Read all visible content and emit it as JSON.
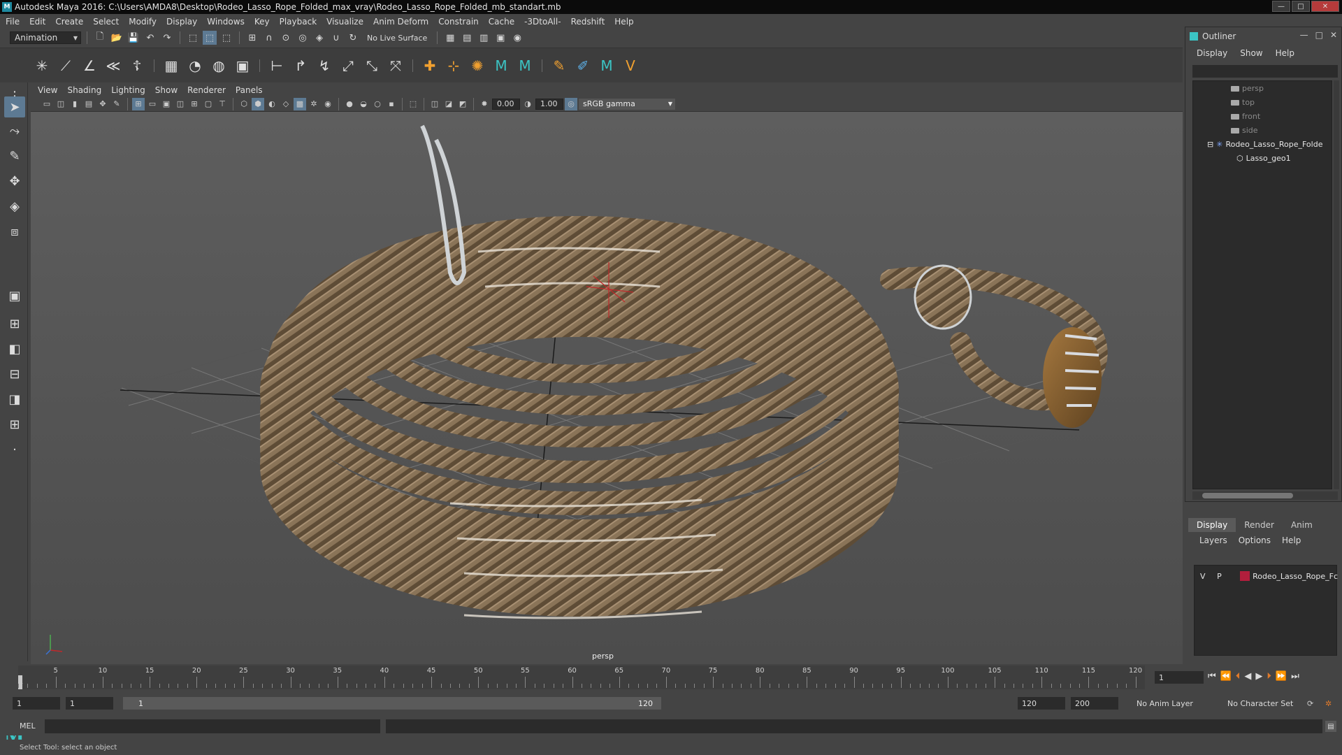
{
  "window": {
    "title": "Autodesk Maya 2016: C:\\Users\\AMDA8\\Desktop\\Rodeo_Lasso_Rope_Folded_max_vray\\Rodeo_Lasso_Rope_Folded_mb_standart.mb"
  },
  "menus": [
    "File",
    "Edit",
    "Create",
    "Select",
    "Modify",
    "Display",
    "Windows",
    "Key",
    "Playback",
    "Visualize",
    "Anim Deform",
    "Constrain",
    "Cache",
    "-3DtoAll-",
    "Redshift",
    "Help"
  ],
  "shelf": {
    "mode": "Animation",
    "live_surface": "No Live Surface"
  },
  "panel": {
    "menus": [
      "View",
      "Shading",
      "Lighting",
      "Show",
      "Renderer",
      "Panels"
    ],
    "exposure": "0.00",
    "gamma": "1.00",
    "color_space": "sRGB gamma",
    "camera_label": "persp"
  },
  "outliner": {
    "title": "Outliner",
    "menus": [
      "Display",
      "Show",
      "Help"
    ],
    "items": [
      {
        "label": "persp",
        "kind": "camera"
      },
      {
        "label": "top",
        "kind": "camera"
      },
      {
        "label": "front",
        "kind": "camera"
      },
      {
        "label": "side",
        "kind": "camera"
      },
      {
        "label": "Rodeo_Lasso_Rope_Folde",
        "kind": "group"
      },
      {
        "label": "Lasso_geo1",
        "kind": "mesh"
      }
    ]
  },
  "layer_editor": {
    "tabs": [
      "Display",
      "Render",
      "Anim"
    ],
    "menus": [
      "Layers",
      "Options",
      "Help"
    ],
    "layer": {
      "v": "V",
      "p": "P",
      "name": "Rodeo_Lasso_Rope_Fc",
      "color": "#b21e3c"
    }
  },
  "timeline": {
    "ticks": [
      "5",
      "10",
      "15",
      "20",
      "25",
      "30",
      "35",
      "40",
      "45",
      "50",
      "55",
      "60",
      "65",
      "70",
      "75",
      "80",
      "85",
      "90",
      "95",
      "100",
      "105",
      "110",
      "115",
      "120"
    ],
    "start_label": "1",
    "current_frame": "1"
  },
  "range": {
    "start": "1",
    "playback_start": "1",
    "slider_start": "1",
    "slider_end": "120",
    "playback_end": "120",
    "end": "200",
    "anim_layer": "No Anim Layer",
    "character_set": "No Character Set"
  },
  "command": {
    "language": "MEL"
  },
  "help_line": "Select Tool: select an object"
}
